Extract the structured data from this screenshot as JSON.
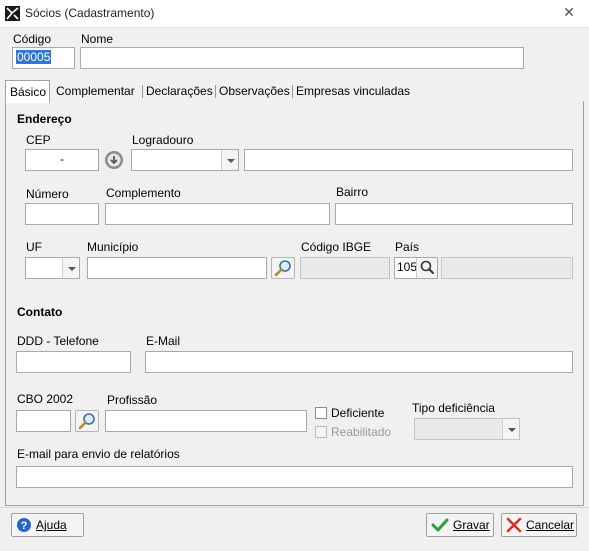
{
  "window": {
    "title": "Sócios (Cadastramento)",
    "close_glyph": "✕",
    "app_icon": "app-logo-icon"
  },
  "header": {
    "codigo_label": "Código",
    "codigo_value": "00005",
    "nome_label": "Nome",
    "nome_value": ""
  },
  "tabs": [
    {
      "label": "Básico",
      "active": true
    },
    {
      "label": "Complementar",
      "active": false
    },
    {
      "label": "Declarações",
      "active": false
    },
    {
      "label": "Observações",
      "active": false
    },
    {
      "label": "Empresas vinculadas",
      "active": false
    }
  ],
  "endereco": {
    "section_title": "Endereço",
    "cep_label": "CEP",
    "cep_value": "-",
    "logradouro_label": "Logradouro",
    "logradouro_type_value": "",
    "logradouro_value": "",
    "numero_label": "Número",
    "numero_value": "",
    "complemento_label": "Complemento",
    "complemento_value": "",
    "bairro_label": "Bairro",
    "bairro_value": "",
    "uf_label": "UF",
    "uf_value": "",
    "municipio_label": "Município",
    "municipio_value": "",
    "codigo_ibge_label": "Código IBGE",
    "codigo_ibge_value": "",
    "pais_label": "País",
    "pais_code": "105",
    "pais_name": ""
  },
  "contato": {
    "section_title": "Contato",
    "ddd_telefone_label": "DDD - Telefone",
    "ddd_telefone_value": "",
    "email_label": "E-Mail",
    "email_value": "",
    "cbo_label": "CBO 2002",
    "cbo_value": "",
    "profissao_label": "Profissão",
    "profissao_value": "",
    "deficiente_label": "Deficiente",
    "reabilitado_label": "Reabilitado",
    "tipo_deficiencia_label": "Tipo deficiência",
    "tipo_deficiencia_value": "",
    "email_relatorios_label": "E-mail para envio de relatórios",
    "email_relatorios_value": ""
  },
  "footer": {
    "ajuda_label": "Ajuda",
    "gravar_label": "Gravar",
    "cancelar_label": "Cancelar"
  },
  "colors": {
    "selection": "#3375d7",
    "help_icon": "#2b64c8",
    "ok_check": "#27a137",
    "cancel_x": "#d9302a"
  }
}
